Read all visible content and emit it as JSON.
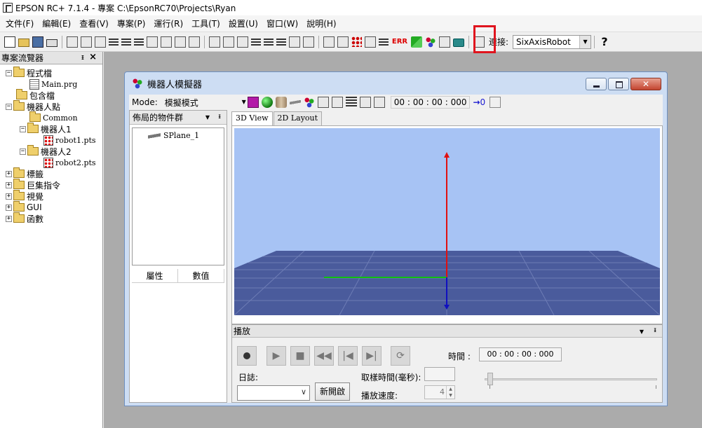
{
  "titlebar": {
    "title": "EPSON RC+ 7.1.4 - 專案 C:\\EpsonRC70\\Projects\\Ryan"
  },
  "menubar": {
    "items": [
      "文件(F)",
      "編輯(E)",
      "查看(V)",
      "專案(P)",
      "運行(R)",
      "工具(T)",
      "設置(U)",
      "窗口(W)",
      "說明(H)"
    ]
  },
  "toolbar": {
    "err_label": "ERR",
    "connect_label": "連接:",
    "connect_value": "SixAxisRobot",
    "help_label": "?"
  },
  "explorer": {
    "title": "專案流覽器",
    "pin": "ᵻ",
    "close": "×",
    "tree": {
      "program_files": "程式檔",
      "main_prg": "Main.prg",
      "include_files": "包含檔",
      "robot_points": "機器人點",
      "common": "Common",
      "robot1": "機器人1",
      "robot1_pts": "robot1.pts",
      "robot2": "機器人2",
      "robot2_pts": "robot2.pts",
      "labels": "標籤",
      "macros": "巨集指令",
      "vision": "視覺",
      "gui": "GUI",
      "functions": "函數"
    }
  },
  "simulator": {
    "title": "機器人模擬器",
    "close_label": "✕",
    "mode_label": "Mode:",
    "mode_value": "模擬模式",
    "time": "00 : 00 : 00 : 000",
    "arrow_count": "0",
    "objects_panel": {
      "title": "佈局的物件群",
      "items": [
        "SPlane_1"
      ],
      "prop_col": "屬性",
      "value_col": "數值"
    },
    "tabs": [
      "3D View",
      "2D Layout"
    ],
    "playback": {
      "title": "播放",
      "time_label": "時間 :",
      "time_value": "00 : 00 : 00 : 000",
      "log_label": "日誌:",
      "new_button": "新開啟",
      "sample_label": "取樣時間(毫秒):",
      "speed_label": "播放速度:",
      "speed_value": "4"
    }
  },
  "colors": {
    "highlight": "#e0141e",
    "sky": "#a7c3f4",
    "floor": "#4a5b9c",
    "axis_z": "#e01010",
    "axis_x": "#10c010",
    "axis_y": "#1010c0"
  }
}
